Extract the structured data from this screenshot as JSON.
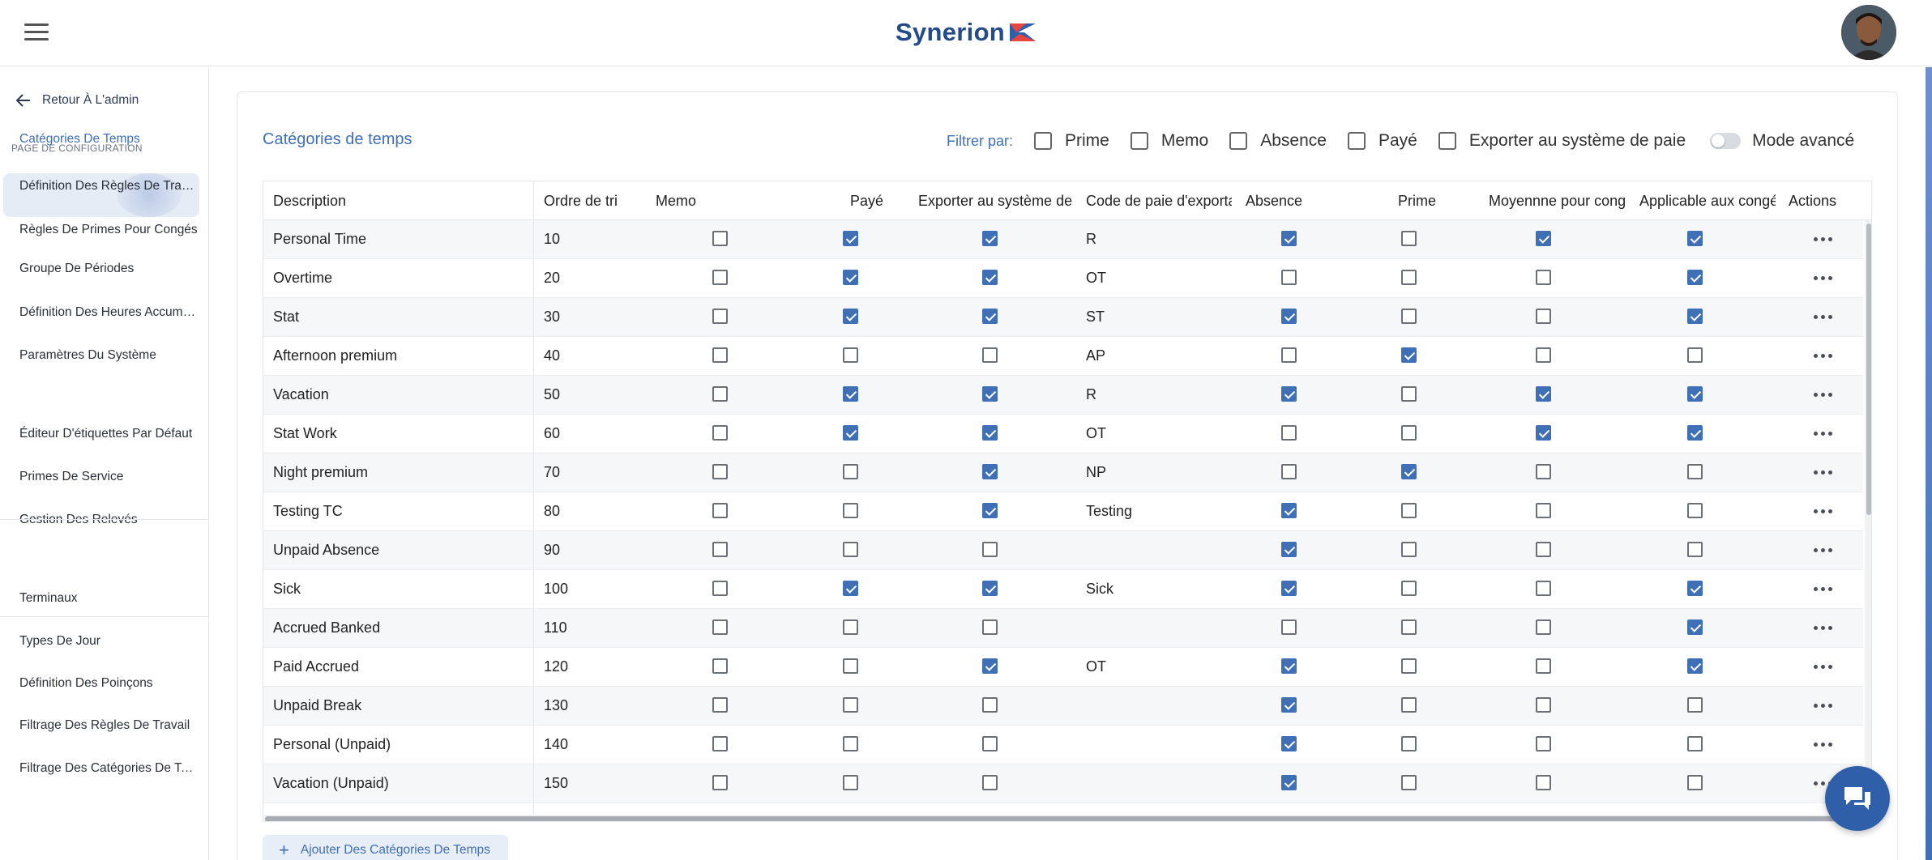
{
  "header": {
    "logo_text": "Synerion",
    "menu_icon": "hamburger-menu-icon",
    "avatar_alt": "user-avatar"
  },
  "sidebar": {
    "back_label": "Retour À L'admin",
    "section_label": "PAGE DE CONFIGURATION",
    "groups": [
      [
        "Catégories De Temps",
        "Définition Des Règles De Travail",
        "Règles De Primes Pour Congés",
        "Groupe De Périodes",
        "Définition Des Heures Accumulées",
        "Paramètres Du Système"
      ],
      [
        "Éditeur D'étiquettes Par Défaut",
        "Primes De Service",
        "Gestion Des Relevés"
      ],
      [
        "Terminaux",
        "Types De Jour",
        "Définition Des Poinçons",
        "Filtrage Des Règles De Travail",
        "Filtrage Des Catégories De Temps"
      ]
    ],
    "active_item": "Catégories De Temps"
  },
  "page": {
    "title": "Catégories de temps",
    "filter_label": "Filtrer par:",
    "filters": [
      "Prime",
      "Memo",
      "Absence",
      "Payé",
      "Exporter au système de paie"
    ],
    "advanced_mode_label": "Mode avancé",
    "advanced_mode_on": false,
    "add_button_label": "Ajouter Des Catégories De Temps"
  },
  "table": {
    "columns": [
      "Description",
      "Ordre de tri",
      "Memo",
      "Payé",
      "Exporter au système de paie",
      "Code de paie d'exportation",
      "Absence",
      "Prime",
      "Moyennne pour congé",
      "Applicable aux congés",
      "Actions"
    ],
    "rows": [
      {
        "description": "Personal Time",
        "order": "10",
        "memo": false,
        "paid": true,
        "export": true,
        "code": "R",
        "absence": true,
        "prime": false,
        "average": true,
        "applicable": true
      },
      {
        "description": "Overtime",
        "order": "20",
        "memo": false,
        "paid": true,
        "export": true,
        "code": "OT",
        "absence": false,
        "prime": false,
        "average": false,
        "applicable": true
      },
      {
        "description": "Stat",
        "order": "30",
        "memo": false,
        "paid": true,
        "export": true,
        "code": "ST",
        "absence": true,
        "prime": false,
        "average": false,
        "applicable": true
      },
      {
        "description": "Afternoon premium",
        "order": "40",
        "memo": false,
        "paid": false,
        "export": false,
        "code": "AP",
        "absence": false,
        "prime": true,
        "average": false,
        "applicable": false
      },
      {
        "description": "Vacation",
        "order": "50",
        "memo": false,
        "paid": true,
        "export": true,
        "code": "R",
        "absence": true,
        "prime": false,
        "average": true,
        "applicable": true
      },
      {
        "description": "Stat Work",
        "order": "60",
        "memo": false,
        "paid": true,
        "export": true,
        "code": "OT",
        "absence": false,
        "prime": false,
        "average": true,
        "applicable": true
      },
      {
        "description": "Night premium",
        "order": "70",
        "memo": false,
        "paid": false,
        "export": true,
        "code": "NP",
        "absence": false,
        "prime": true,
        "average": false,
        "applicable": false
      },
      {
        "description": "Testing TC",
        "order": "80",
        "memo": false,
        "paid": false,
        "export": true,
        "code": "Testing",
        "absence": true,
        "prime": false,
        "average": false,
        "applicable": false
      },
      {
        "description": "Unpaid Absence",
        "order": "90",
        "memo": false,
        "paid": false,
        "export": false,
        "code": "",
        "absence": true,
        "prime": false,
        "average": false,
        "applicable": false
      },
      {
        "description": "Sick",
        "order": "100",
        "memo": false,
        "paid": true,
        "export": true,
        "code": "Sick",
        "absence": true,
        "prime": false,
        "average": false,
        "applicable": true
      },
      {
        "description": "Accrued Banked",
        "order": "110",
        "memo": false,
        "paid": false,
        "export": false,
        "code": "",
        "absence": false,
        "prime": false,
        "average": false,
        "applicable": true
      },
      {
        "description": "Paid Accrued",
        "order": "120",
        "memo": false,
        "paid": false,
        "export": true,
        "code": "OT",
        "absence": true,
        "prime": false,
        "average": false,
        "applicable": true
      },
      {
        "description": "Unpaid Break",
        "order": "130",
        "memo": false,
        "paid": false,
        "export": false,
        "code": "",
        "absence": true,
        "prime": false,
        "average": false,
        "applicable": false
      },
      {
        "description": "Personal (Unpaid)",
        "order": "140",
        "memo": false,
        "paid": false,
        "export": false,
        "code": "",
        "absence": true,
        "prime": false,
        "average": false,
        "applicable": false
      },
      {
        "description": "Vacation (Unpaid)",
        "order": "150",
        "memo": false,
        "paid": false,
        "export": false,
        "code": "",
        "absence": true,
        "prime": false,
        "average": false,
        "applicable": false
      }
    ]
  },
  "colors": {
    "accent": "#3f6fb5",
    "brand": "#234b8a"
  }
}
